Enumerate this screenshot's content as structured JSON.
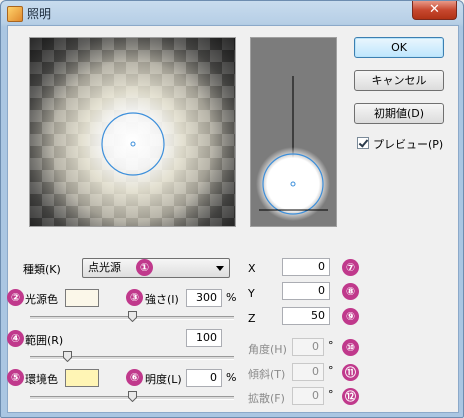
{
  "window": {
    "title": "照明",
    "close_glyph": "✕"
  },
  "buttons": {
    "ok": "OK",
    "cancel": "キャンセル",
    "reset": "初期値(D)"
  },
  "preview_checkbox": {
    "label": "プレビュー(P)",
    "checked": true
  },
  "light_type": {
    "label": "種類(K)",
    "value": "点光源",
    "badge": "①"
  },
  "light_color": {
    "label": "光源色",
    "badge": "②",
    "color": "#fbf7e9"
  },
  "intensity": {
    "label": "強さ(I)",
    "value": "300",
    "unit": "%",
    "badge": "③",
    "slider_value": 0.5
  },
  "range": {
    "label": "範囲(R)",
    "value": "100",
    "badge": "④",
    "slider_value": 0.17
  },
  "ambient_color": {
    "label": "環境色",
    "badge": "⑤",
    "color": "#fff5b5"
  },
  "brightness": {
    "label": "明度(L)",
    "value": "0",
    "unit": "%",
    "badge": "⑥",
    "slider_value": 0.5
  },
  "position": {
    "x": {
      "label": "X",
      "value": "0",
      "badge": "⑦"
    },
    "y": {
      "label": "Y",
      "value": "0",
      "badge": "⑧"
    },
    "z": {
      "label": "Z",
      "value": "50",
      "badge": "⑨"
    }
  },
  "angle": {
    "label": "角度(H)",
    "value": "0",
    "unit": "°",
    "badge": "⑩",
    "enabled": false
  },
  "tilt": {
    "label": "傾斜(T)",
    "value": "0",
    "unit": "°",
    "badge": "⑪",
    "enabled": false
  },
  "spread": {
    "label": "拡散(F)",
    "value": "0",
    "unit": "°",
    "badge": "⑫",
    "enabled": false
  },
  "colors": {
    "accent": "#3c7fb1",
    "badge": "#c0398c",
    "light_circle": "#3c8fdb"
  }
}
